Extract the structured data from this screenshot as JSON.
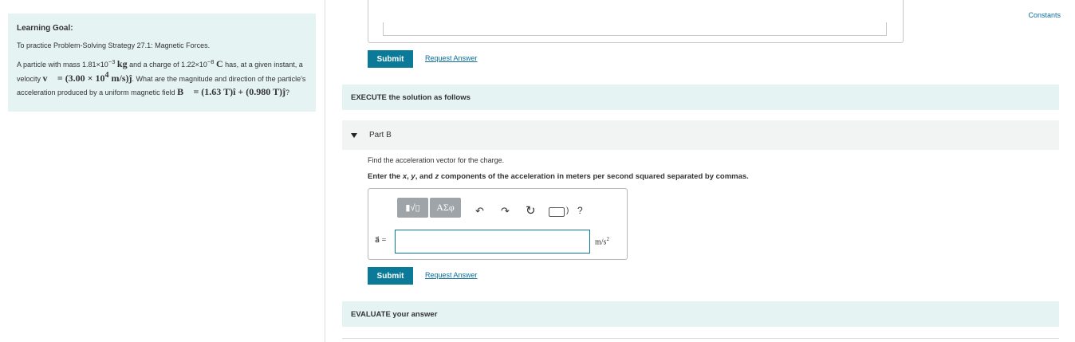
{
  "goal": {
    "title": "Learning Goal:",
    "line1": "To practice Problem-Solving Strategy 27.1: Magnetic Forces.",
    "p_a": "A particle with mass 1.81×10",
    "mass_exp": "−3",
    "mass_unit": "kg",
    "p_b": " and a charge of 1.22×10",
    "charge_exp": "−8",
    "charge_unit": "C",
    "p_c": " has, at a given instant, a velocity ",
    "v_expr": "v⃗ = (3.00 × 10",
    "v_exp": "4",
    "v_tail": " m/s)ĵ",
    "p_d": ". What are the magnitude and direction of the particle's acceleration  produced by a uniform magnetic field ",
    "b_expr": "B⃗ = (1.63 T)î + (0.980 T)ĵ",
    "p_e": "?"
  },
  "constants_label": "Constants",
  "buttons": {
    "submit_top": "Submit",
    "request_top": "Request Answer",
    "submit_bottom": "Submit",
    "request_bottom": "Request Answer"
  },
  "bands": {
    "execute": "EXECUTE the solution as follows",
    "evaluate": "EVALUATE your answer"
  },
  "part": {
    "title": "Part B",
    "prompt1": "Find the acceleration vector for the charge.",
    "prompt2_a": "Enter the ",
    "prompt2_x": "x",
    "prompt2_b": ", ",
    "prompt2_y": "y",
    "prompt2_c": ", and ",
    "prompt2_z": "z",
    "prompt2_d": " components of the acceleration in meters per second squared separated by commas."
  },
  "editor": {
    "tool_templates": "▮√▯",
    "tool_symbols": "ΑΣφ",
    "help": "?",
    "label": "a⃗ =",
    "value": "",
    "unit": "m/s",
    "unit_exp": "2"
  },
  "colors": {
    "accent": "#0b7a98",
    "panel_bg": "#e5f3f3",
    "link": "#0b6e9c"
  }
}
